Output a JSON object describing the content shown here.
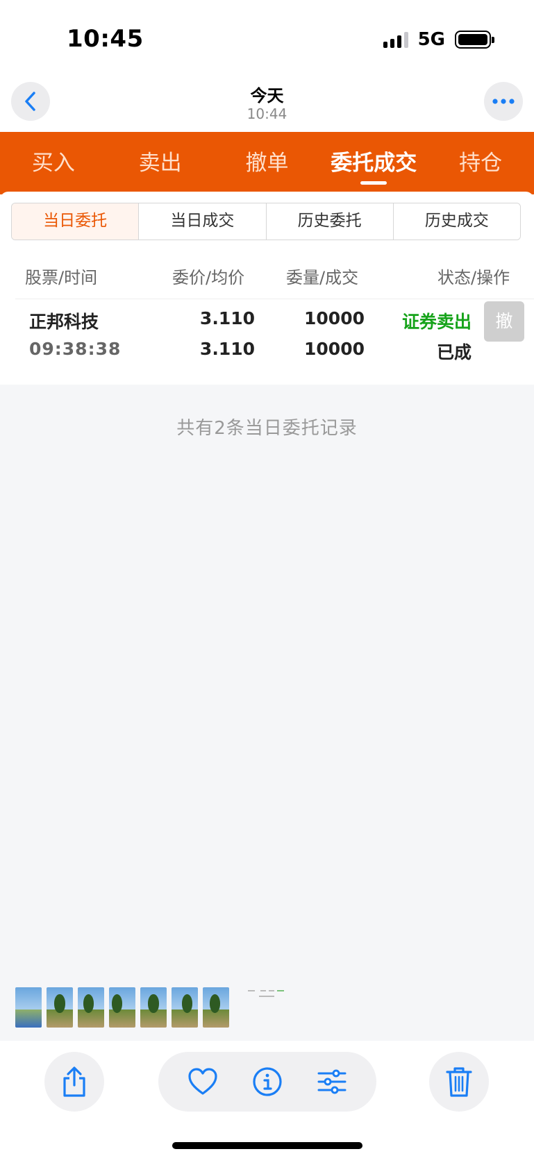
{
  "status_bar": {
    "time": "10:45",
    "network": "5G"
  },
  "header": {
    "title": "今天",
    "subtitle": "10:44"
  },
  "main_tabs": [
    {
      "label": "买入"
    },
    {
      "label": "卖出"
    },
    {
      "label": "撤单"
    },
    {
      "label": "委托成交"
    },
    {
      "label": "持仓"
    }
  ],
  "active_main_tab": "委托成交",
  "sub_tabs": [
    {
      "label": "当日委托"
    },
    {
      "label": "当日成交"
    },
    {
      "label": "历史委托"
    },
    {
      "label": "历史成交"
    }
  ],
  "active_sub_tab": "当日委托",
  "columns": [
    "股票/时间",
    "委价/均价",
    "委量/成交",
    "状态/操作"
  ],
  "orders": [
    {
      "name": "正邦科技",
      "time": "09:38:38",
      "order_price": "3.110",
      "avg_price": "3.110",
      "order_qty": "10000",
      "filled_qty": "10000",
      "type": "证券卖出",
      "state": "已成",
      "action": "撤"
    }
  ],
  "record_summary": "共有2条当日委托记录",
  "colors": {
    "brand_orange": "#ea5704",
    "sell_green": "#16a31a",
    "ios_blue": "#1a7ef5"
  },
  "toolbar_icons": [
    "share-icon",
    "heart-icon",
    "info-icon",
    "adjust-icon",
    "trash-icon"
  ]
}
